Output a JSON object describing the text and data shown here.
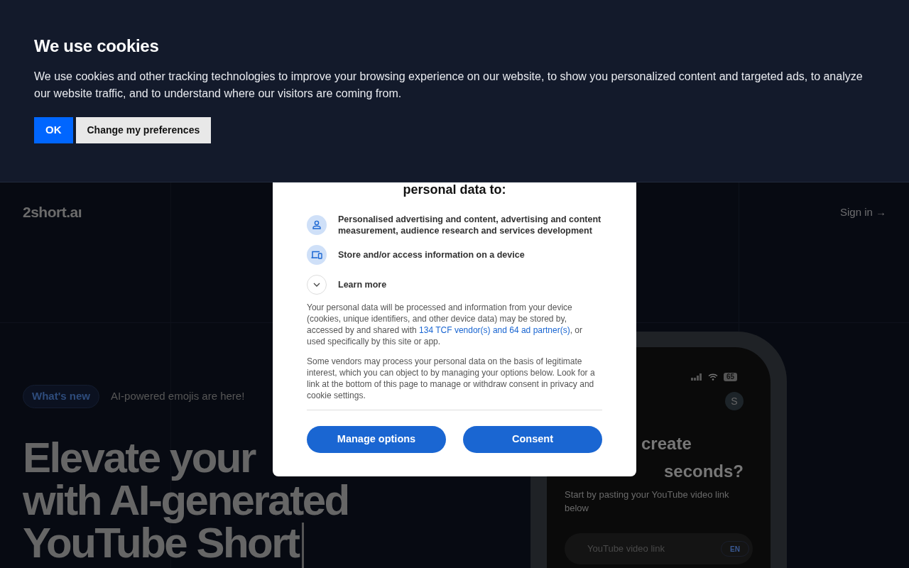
{
  "cookie_banner": {
    "title": "We use cookies",
    "text": "We use cookies and other tracking technologies to improve your browsing experience on our website, to show you personalized content and targeted ads, to analyze our website traffic, and to understand where our visitors are coming from.",
    "buttons": [
      {
        "label": "OK",
        "kind": "primary"
      },
      {
        "label": "Change my preferences",
        "kind": "secondary"
      }
    ]
  },
  "header": {
    "logo": "2short.aı",
    "sign_in": "Sign in →"
  },
  "announcement": {
    "badge": "What's new",
    "text": "AI-powered emojis are here!"
  },
  "headline": [
    "Elevate your",
    "with AI-generated",
    "YouTube Short"
  ],
  "phone": {
    "battery": "65",
    "avatar": "S",
    "title_lines": [
      "create",
      "seconds?"
    ],
    "subtitle": "Start by pasting your YouTube video link below",
    "search_placeholder": "YouTube video link",
    "language": "EN"
  },
  "consent_dialog": {
    "title": "personal data to:",
    "purposes": [
      {
        "kind": "person",
        "text": "Personalised advertising and content, advertising and content measurement, audience research and services development"
      },
      {
        "kind": "device",
        "text": "Store and/or access information on a device"
      }
    ],
    "learn_more": {
      "label": "Learn more",
      "expanded": false
    },
    "paragraph_1": {
      "before": "Your personal data will be processed and information from your device (cookies, unique identifiers, and other device data) may be stored by, accessed by and shared with ",
      "link": "134 TCF vendor(s) and 64 ad partner(s)",
      "after": ", or used specifically by this site or app."
    },
    "paragraph_2": "Some vendors may process your personal data on the basis of legitimate interest, which you can object to by managing your options below. Look for a link at the bottom of this page to manage or withdraw consent in privacy and cookie settings.",
    "buttons": [
      "Manage options",
      "Consent"
    ]
  }
}
